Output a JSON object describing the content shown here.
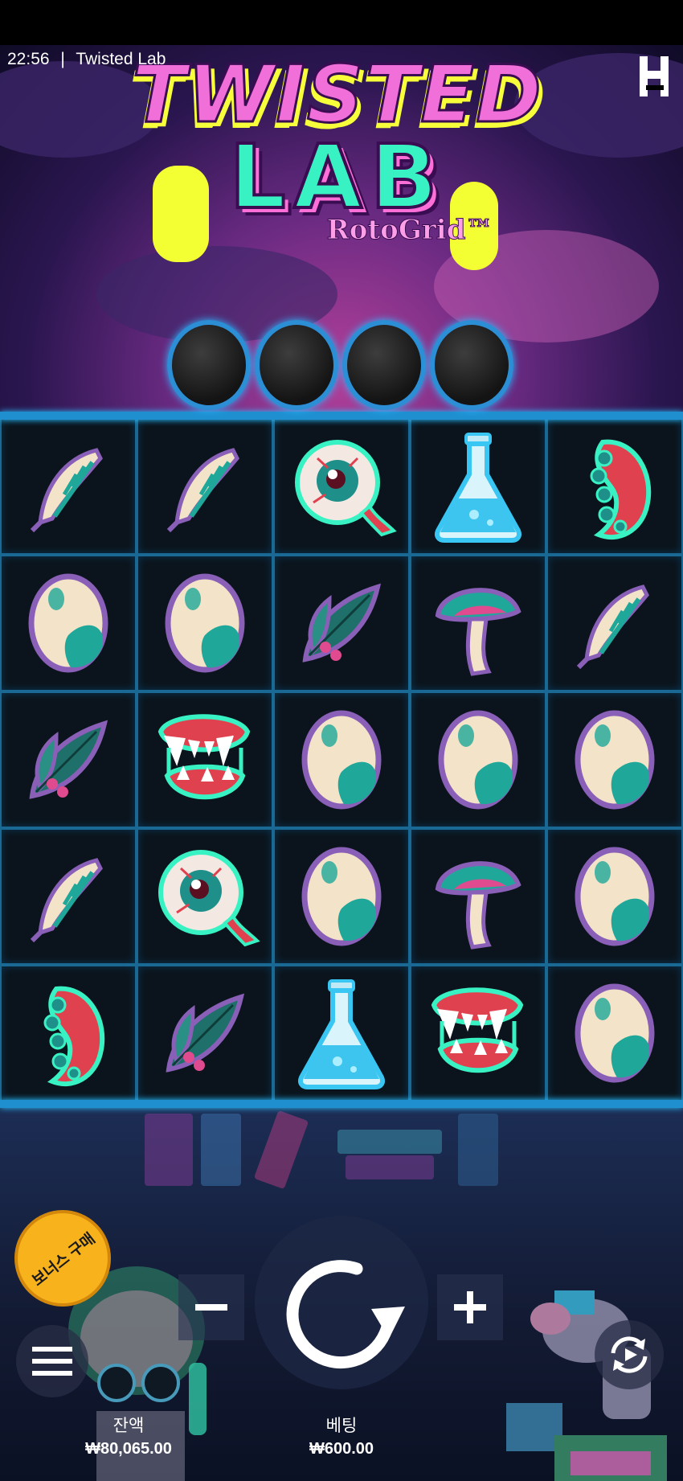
{
  "status": {
    "time": "22:56",
    "separator": "|",
    "app_title": "Twisted Lab"
  },
  "logo": {
    "line1": "TWISTED",
    "line2": "LAB",
    "subtitle": "RotoGrid™"
  },
  "colors": {
    "grid_line": "#1a6894",
    "divider": "#1f8fd0",
    "bonus": "#f8b21c"
  },
  "reels": [
    [
      "feather",
      "feather",
      "eyeball",
      "flask",
      "tentacle"
    ],
    [
      "egg",
      "egg",
      "leaf",
      "mushroom",
      "feather"
    ],
    [
      "leaf",
      "fangs",
      "egg",
      "egg",
      "egg"
    ],
    [
      "feather",
      "eyeball",
      "egg",
      "mushroom",
      "egg"
    ],
    [
      "tentacle",
      "leaf",
      "flask",
      "fangs",
      "egg"
    ]
  ],
  "controls": {
    "bonus_buy_label": "보너스 구매",
    "minus_icon": "minus-icon",
    "plus_icon": "plus-icon",
    "spin_icon": "spin-icon",
    "menu_icon": "menu-icon",
    "autoplay_icon": "autoplay-icon"
  },
  "balance": {
    "label": "잔액",
    "value": "₩80,065.00"
  },
  "bet": {
    "label": "베팅",
    "value": "₩600.00"
  }
}
